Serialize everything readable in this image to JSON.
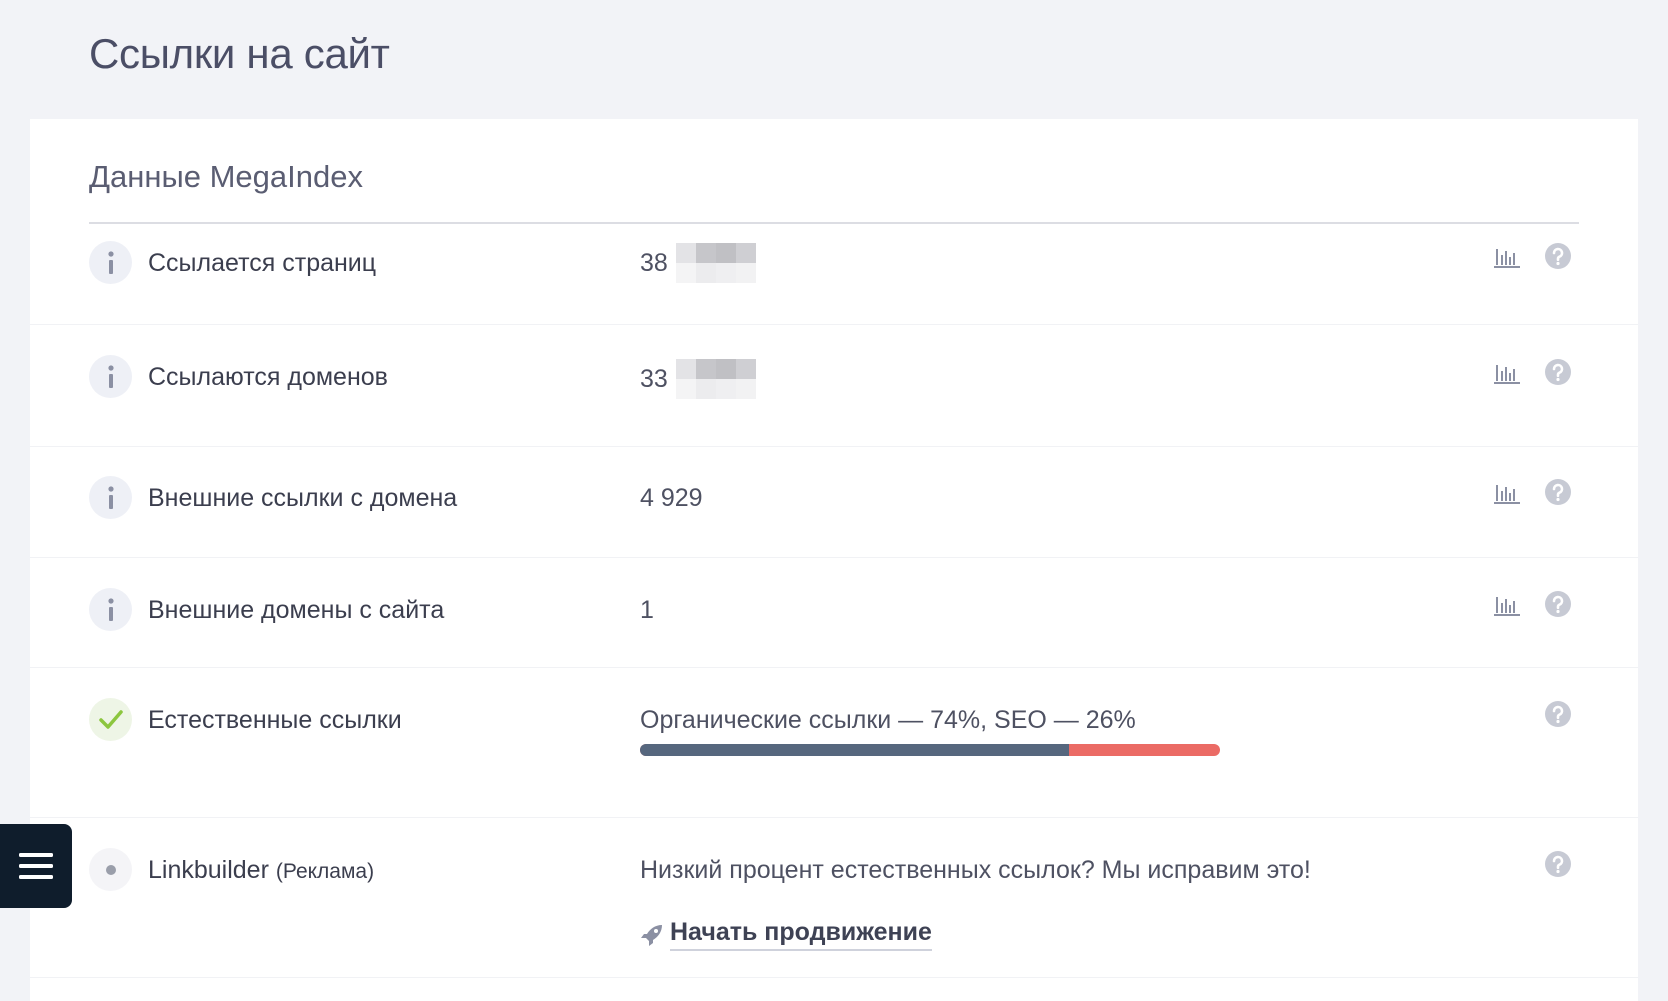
{
  "page": {
    "title": "Ссылки на сайт"
  },
  "card": {
    "title": "Данные MegaIndex"
  },
  "rows": [
    {
      "label": "Ссылается страниц",
      "value": "38",
      "icon": "info-icon",
      "has_chart": true
    },
    {
      "label": "Ссылаются доменов",
      "value": "33",
      "icon": "info-icon",
      "has_chart": true
    },
    {
      "label": "Внешние ссылки с домена",
      "value": "4 929",
      "icon": "info-icon",
      "has_chart": true
    },
    {
      "label": "Внешние домены с сайта",
      "value": "1",
      "icon": "info-icon",
      "has_chart": true
    },
    {
      "label": "Естественные ссылки",
      "value": "Органические ссылки — 74%, SEO — 26%",
      "icon": "check-icon",
      "has_chart": false
    },
    {
      "label": "Linkbuilder",
      "label_suffix": "(Реклама)",
      "value": "Низкий процент естественных ссылок? Мы исправим это!",
      "icon": "dot-icon",
      "has_chart": false
    }
  ],
  "natural_links": {
    "organic_percent": 74,
    "seo_percent": 26,
    "organic_color": "#56677e",
    "seo_color": "#eb6b65"
  },
  "promo": {
    "link_label": "Начать продвижение",
    "icon": "rocket-icon"
  },
  "colors": {
    "background": "#f2f3f7",
    "card": "#ffffff",
    "menu_button": "#0f1d2c",
    "check": "#8cc63f"
  },
  "menu": {
    "icon": "hamburger-icon"
  }
}
